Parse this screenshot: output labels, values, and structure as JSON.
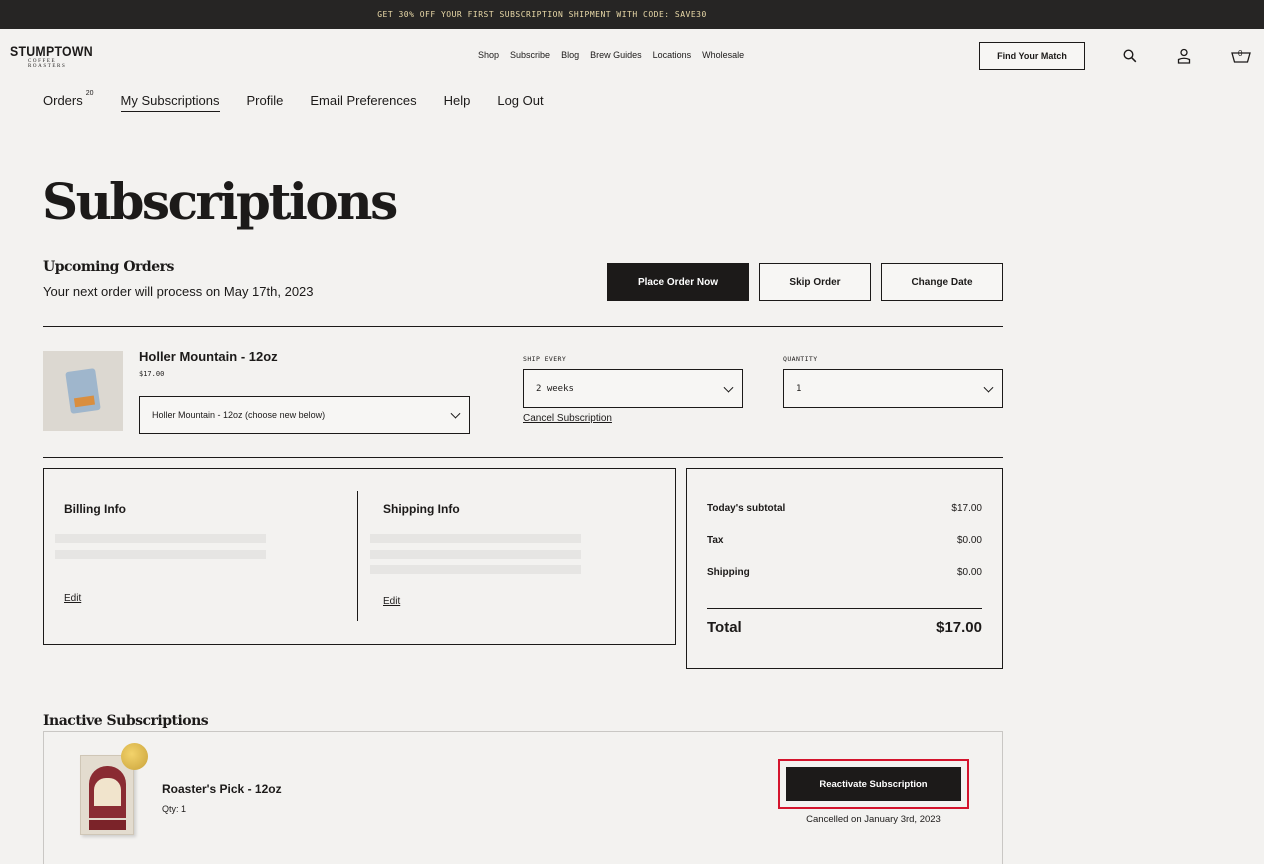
{
  "promo": {
    "text": "GET 30% OFF YOUR FIRST SUBSCRIPTION SHIPMENT WITH CODE: SAVE30"
  },
  "brand": {
    "name": "STUMPTOWN",
    "tagline": "COFFEE ROASTERS"
  },
  "main_nav": [
    "Shop",
    "Subscribe",
    "Blog",
    "Brew Guides",
    "Locations",
    "Wholesale"
  ],
  "header": {
    "match_button": "Find Your Match",
    "cart_count": "0"
  },
  "account_nav": {
    "orders": "Orders",
    "orders_count": "20",
    "subscriptions": "My Subscriptions",
    "profile": "Profile",
    "email": "Email Preferences",
    "help": "Help",
    "logout": "Log Out"
  },
  "page": {
    "title": "Subscriptions"
  },
  "upcoming": {
    "title": "Upcoming Orders",
    "subtitle": "Your next order will process on May 17th, 2023",
    "place_order": "Place Order Now",
    "skip_order": "Skip Order",
    "change_date": "Change Date"
  },
  "product": {
    "name": "Holler Mountain - 12oz",
    "price": "$17.00",
    "variant_select": "Holler Mountain - 12oz (choose new below)",
    "ship_label": "SHIP EVERY",
    "ship_value": "2 weeks",
    "qty_label": "QUANTITY",
    "qty_value": "1",
    "cancel_link": "Cancel Subscription"
  },
  "billing": {
    "title": "Billing Info",
    "edit": "Edit"
  },
  "shipping": {
    "title": "Shipping Info",
    "edit": "Edit"
  },
  "summary": {
    "subtotal_label": "Today's subtotal",
    "subtotal": "$17.00",
    "tax_label": "Tax",
    "tax": "$0.00",
    "shipping_label": "Shipping",
    "shipping": "$0.00",
    "total_label": "Total",
    "total": "$17.00"
  },
  "inactive": {
    "title": "Inactive Subscriptions",
    "name": "Roaster's Pick - 12oz",
    "qty": "Qty: 1",
    "reactivate": "Reactivate Subscription",
    "cancelled": "Cancelled on January 3rd, 2023"
  },
  "colors": {
    "dark": "#1c1a19",
    "background": "#f3f2f0",
    "highlight": "#d4142d"
  }
}
